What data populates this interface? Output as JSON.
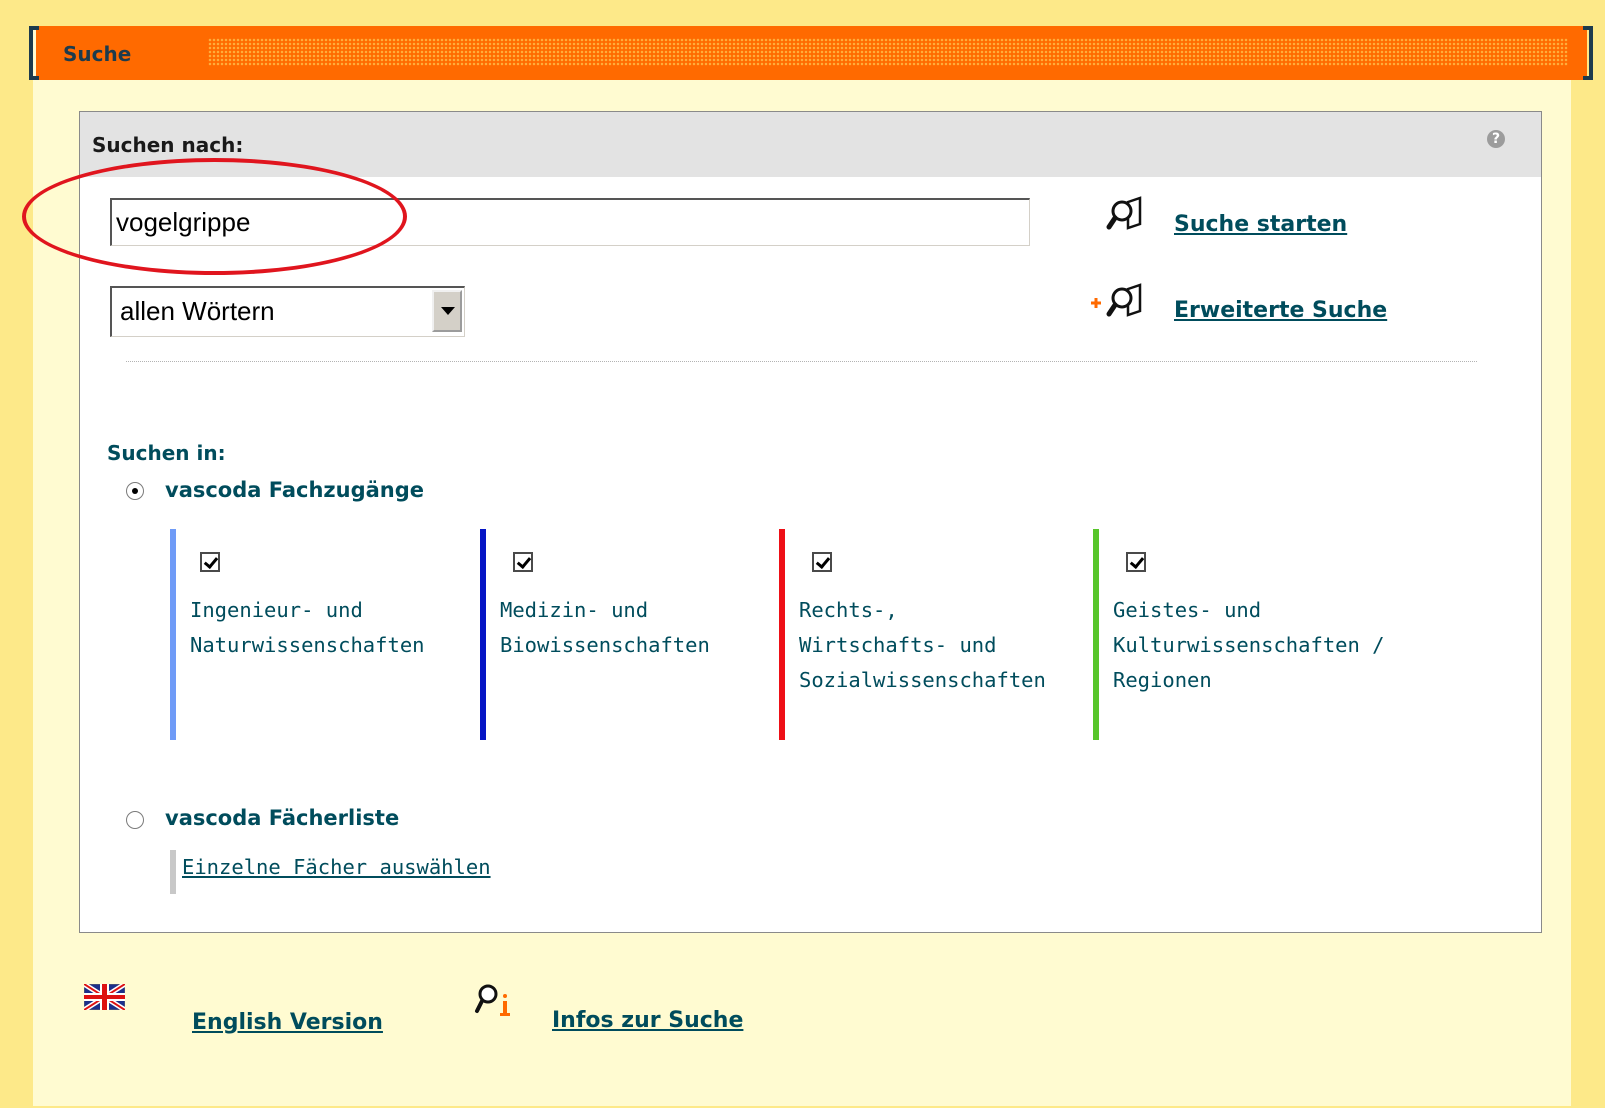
{
  "header": {
    "title": "Suche"
  },
  "search": {
    "for_label": "Suchen nach:",
    "query_value": "vogelgrippe",
    "mode_selected": "allen Wörtern",
    "start_label": "Suche starten",
    "advanced_label": "Erweiterte Suche"
  },
  "scope": {
    "label": "Suchen in:",
    "fachzugaenge_label": "vascoda Fachzugänge",
    "fachzugaenge_checked": true,
    "categories": [
      {
        "label": "Ingenieur- und\nNaturwissenschaften",
        "color": "#6f9bf7",
        "checked": true
      },
      {
        "label": "Medizin- und\nBiowissenschaften",
        "color": "#0515c5",
        "checked": true
      },
      {
        "label": "Rechts-,\nWirtschafts- und\nSozialwissenschaften",
        "color": "#ee0f16",
        "checked": true
      },
      {
        "label": "Geistes- und\nKulturwissenschaften /\nRegionen",
        "color": "#57c62a",
        "checked": true
      }
    ],
    "faecherliste_label": "vascoda Fächerliste",
    "faecherliste_checked": false,
    "single_subjects_link": "Einzelne Fächer auswählen"
  },
  "footer": {
    "english_label": "English Version",
    "info_label": "Infos zur Suche"
  },
  "colors": {
    "background": "#fde989",
    "header": "#ff6a00",
    "link": "#004c5c",
    "highlight": "#e0151e"
  }
}
